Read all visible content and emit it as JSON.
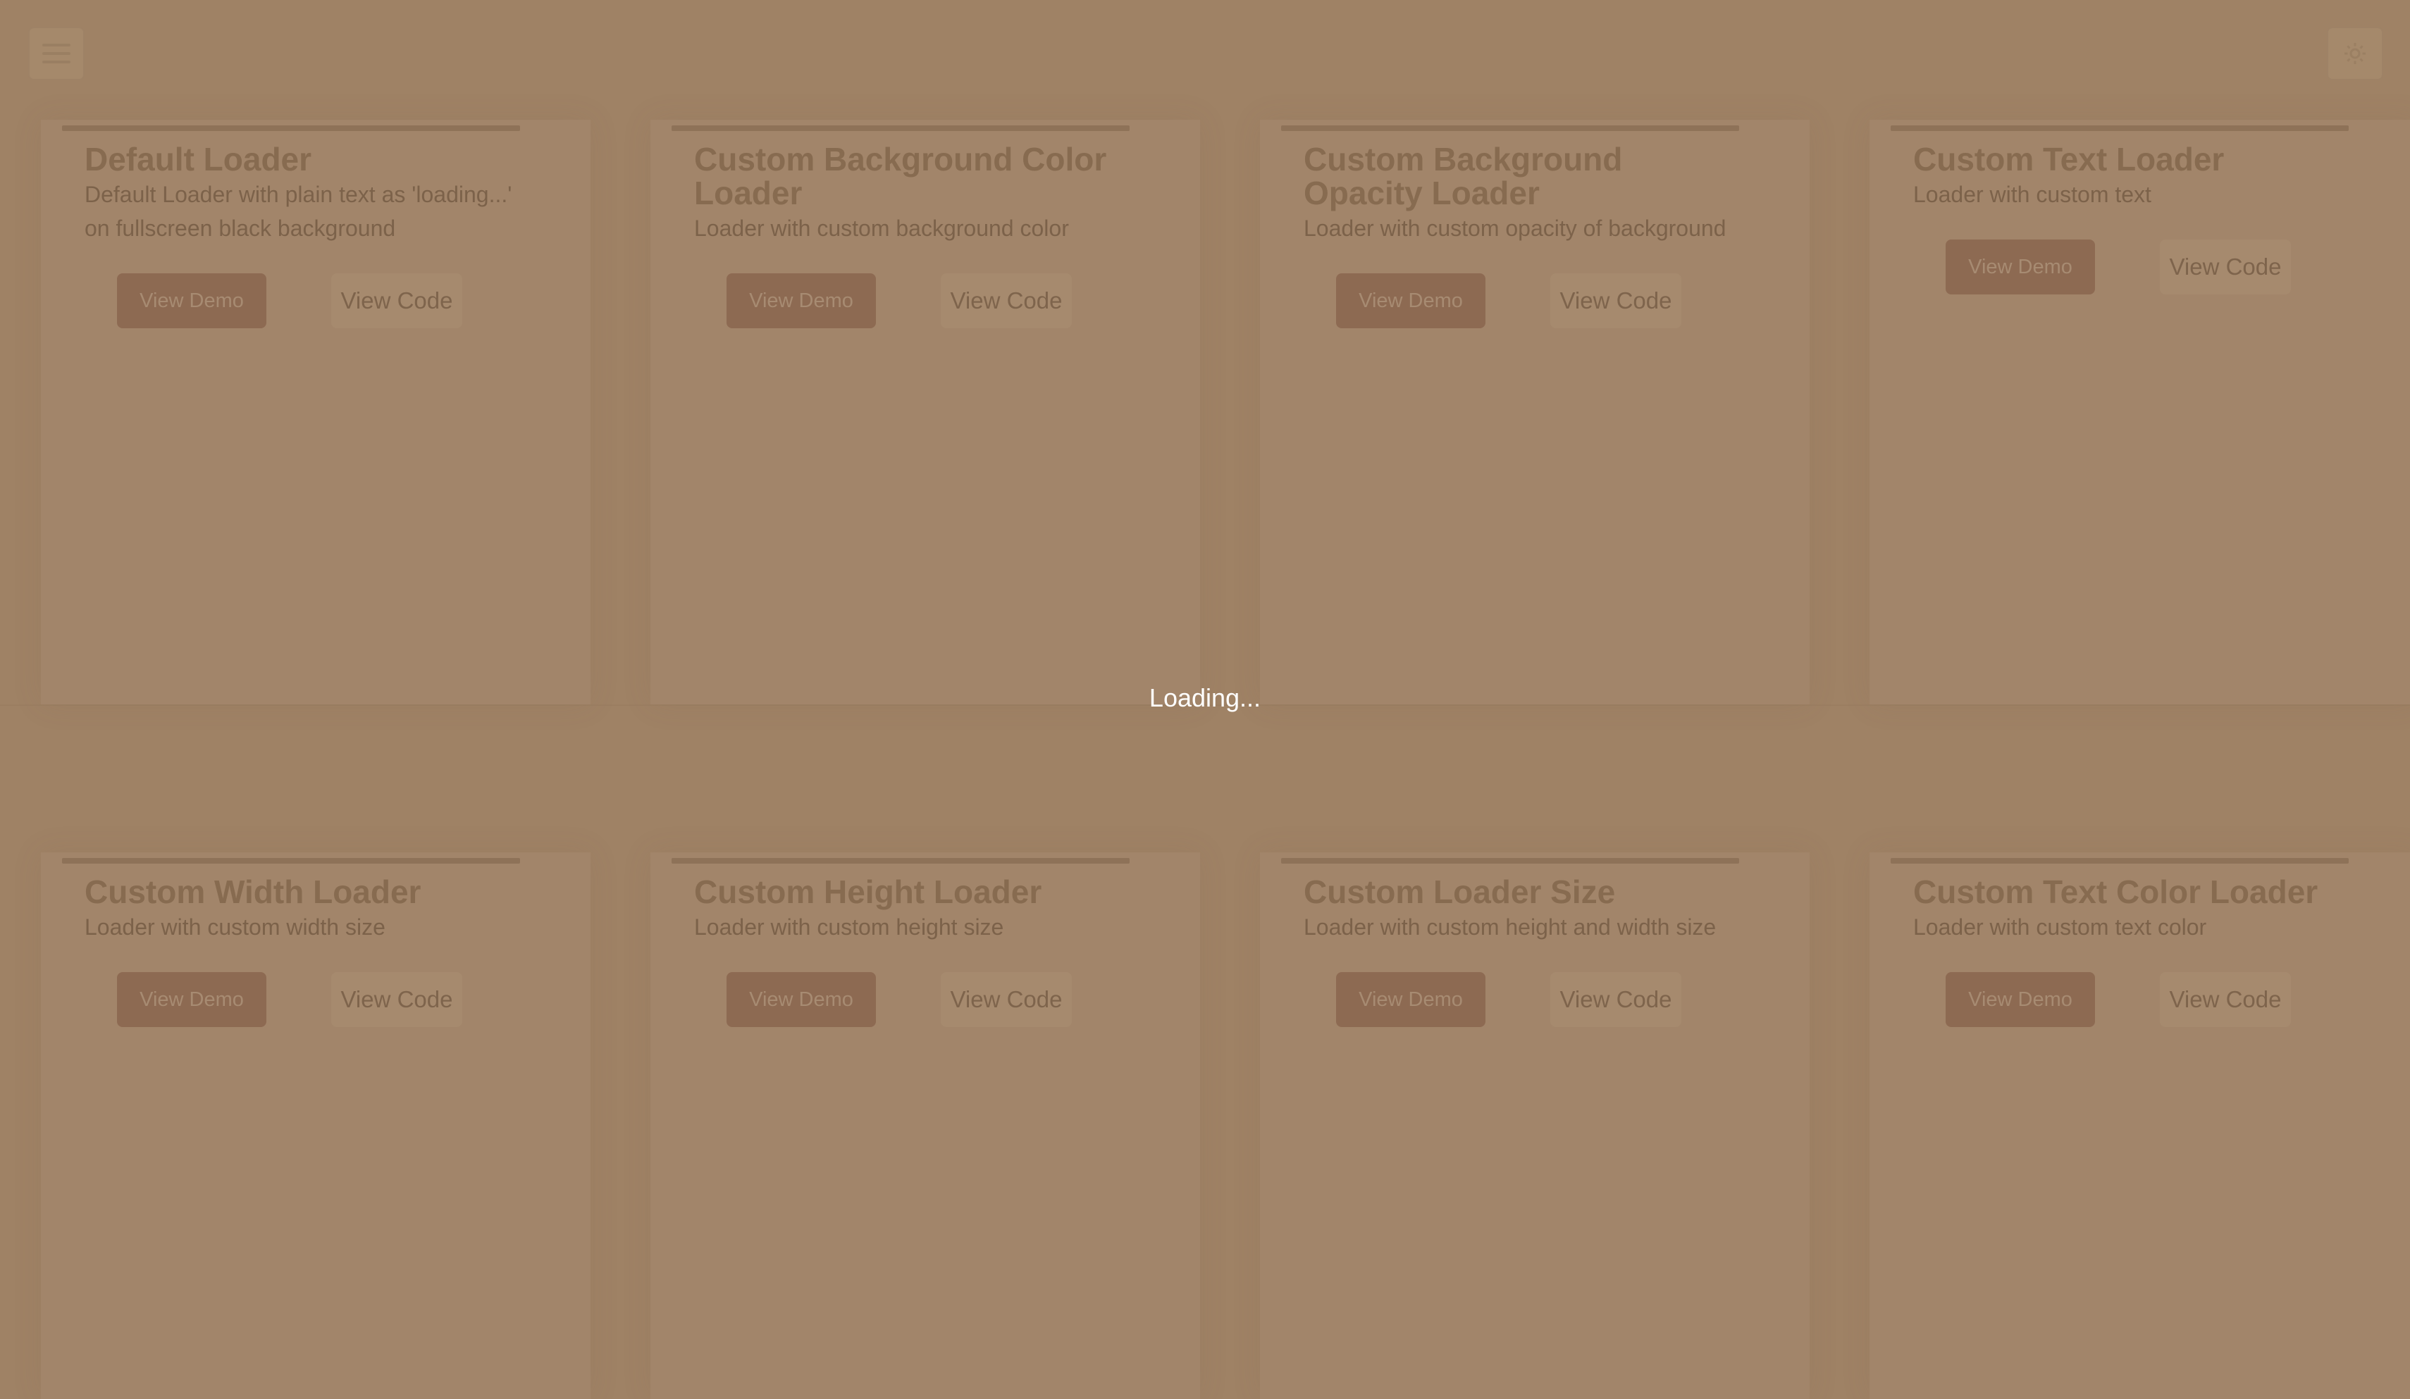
{
  "overlay": {
    "loading_text": "Loading...",
    "background_color": "#9f8265"
  },
  "header": {
    "menu_icon": "menu-icon",
    "settings_icon": "gear-icon"
  },
  "cards": [
    {
      "title": "Default Loader",
      "description": "Default Loader with plain text as 'loading...' on fullscreen black background",
      "demo_label": "View Demo",
      "code_label": "View Code"
    },
    {
      "title": "Custom Background Color Loader",
      "description": "Loader with custom background color",
      "demo_label": "View Demo",
      "code_label": "View Code"
    },
    {
      "title": "Custom Background Opacity Loader",
      "description": "Loader with custom opacity of background",
      "demo_label": "View Demo",
      "code_label": "View Code"
    },
    {
      "title": "Custom Text Loader",
      "description": "Loader with custom text",
      "demo_label": "View Demo",
      "code_label": "View Code"
    },
    {
      "title": "Custom Width Loader",
      "description": "Loader with custom width size",
      "demo_label": "View Demo",
      "code_label": "View Code"
    },
    {
      "title": "Custom Height Loader",
      "description": "Loader with custom height size",
      "demo_label": "View Demo",
      "code_label": "View Code"
    },
    {
      "title": "Custom Loader Size",
      "description": "Loader with custom height and width size",
      "demo_label": "View Demo",
      "code_label": "View Code"
    },
    {
      "title": "Custom Text Color Loader",
      "description": "Loader with custom text color",
      "demo_label": "View Demo",
      "code_label": "View Code"
    }
  ],
  "colors": {
    "button_primary": "#8d6a52",
    "button_secondary": "#a68a6e",
    "title_text": "#876b50",
    "loading_text": "#ffffff"
  }
}
